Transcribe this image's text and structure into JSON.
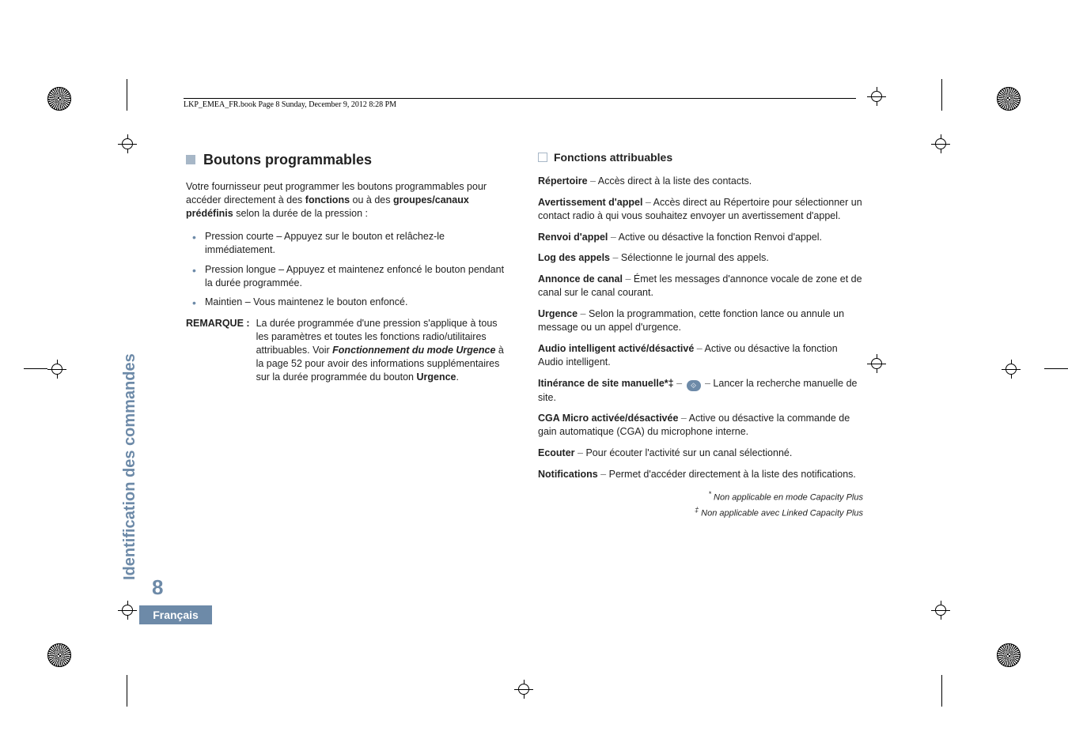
{
  "header_line": "LKP_EMEA_FR.book  Page 8  Sunday, December 9, 2012  8:28 PM",
  "side_label": "Identification des commandes",
  "page_number": "8",
  "language_tab": "Français",
  "left": {
    "title": "Boutons programmables",
    "intro_pre": "Votre fournisseur peut programmer les boutons programmables pour accéder directement à des ",
    "intro_bold1": "fonctions",
    "intro_mid": " ou à des ",
    "intro_bold2": "groupes/canaux prédéfinis",
    "intro_post": " selon la durée de la pression :",
    "bullets": [
      "Pression courte – Appuyez sur le bouton et relâchez-le immédiatement.",
      "Pression longue – Appuyez et maintenez enfoncé le bouton pendant la durée programmée.",
      "Maintien – Vous maintenez le bouton enfoncé."
    ],
    "remarque_label": "REMARQUE :",
    "remarque_pre": "La durée programmée d'une pression s'applique à tous les paramètres et toutes les fonctions radio/utilitaires attribuables. Voir ",
    "remarque_bolditalic": "Fonctionnement du mode Urgence",
    "remarque_mid": " à la page 52 pour avoir des informations supplémentaires sur la durée programmée du bouton ",
    "remarque_bold2": "Urgence",
    "remarque_end": "."
  },
  "right": {
    "title": "Fonctions attribuables",
    "entries": [
      {
        "name": "Répertoire",
        "desc": "Accès direct à la liste des contacts."
      },
      {
        "name": "Avertissement d'appel",
        "desc": "Accès direct au Répertoire pour sélectionner un contact radio à qui vous souhaitez envoyer un avertissement d'appel."
      },
      {
        "name": "Renvoi d'appel",
        "desc": "Active ou désactive la fonction Renvoi d'appel."
      },
      {
        "name": "Log des appels",
        "desc": "Sélectionne le journal des appels."
      },
      {
        "name": "Annonce de canal",
        "desc": "Émet les messages d'annonce vocale de zone et de canal sur le canal courant."
      },
      {
        "name": "Urgence",
        "desc": "Selon la programmation, cette fonction lance ou annule un message ou un appel d'urgence."
      },
      {
        "name": "Audio intelligent activé/désactivé",
        "desc": "Active ou désactive la fonction Audio intelligent."
      },
      {
        "name": "Itinérance de site manuelle*‡",
        "desc": "Lancer la recherche manuelle de site.",
        "icon": true
      },
      {
        "name": "CGA Micro activée/désactivée",
        "desc": "Active ou désactive la commande de gain automatique (CGA) du microphone interne."
      },
      {
        "name": "Ecouter",
        "desc": "Pour écouter l'activité sur un canal sélectionné."
      },
      {
        "name": "Notifications",
        "desc": "Permet d'accéder directement à la liste des notifications."
      }
    ],
    "footnotes": [
      {
        "mark": "*",
        "text": "Non applicable en mode Capacity Plus"
      },
      {
        "mark": "‡",
        "text": "Non applicable avec Linked Capacity Plus"
      }
    ]
  }
}
